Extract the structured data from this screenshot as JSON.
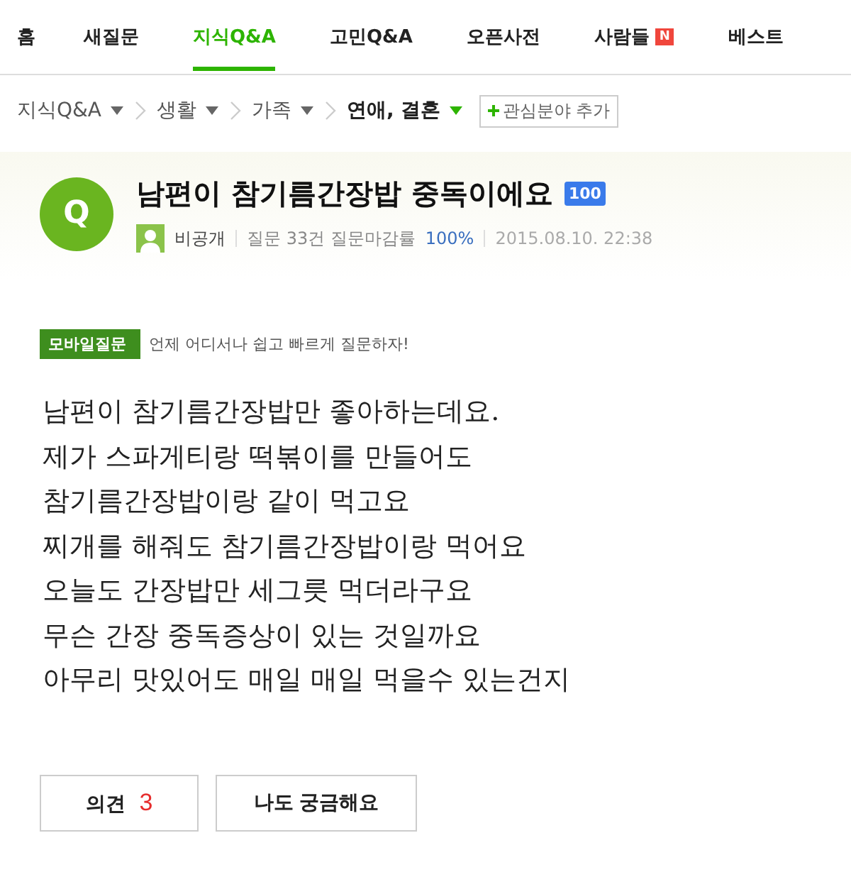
{
  "nav": [
    {
      "label": "홈",
      "selected": false
    },
    {
      "label": "새질문",
      "selected": false
    },
    {
      "label": "지식Q&A",
      "selected": true
    },
    {
      "label": "고민Q&A",
      "selected": false
    },
    {
      "label": "오픈사전",
      "selected": false
    },
    {
      "label": "사람들",
      "selected": false,
      "badge": "N"
    },
    {
      "label": "베스트",
      "selected": false
    }
  ],
  "breadcrumb": [
    {
      "label": "지식Q&A",
      "current": false
    },
    {
      "label": "생활",
      "current": false
    },
    {
      "label": "가족",
      "current": false
    },
    {
      "label": "연애, 결혼",
      "current": true
    }
  ],
  "add_interest": "관심분야 추가",
  "question": {
    "badge": "Q",
    "title": "남편이 참기름간장밥 중독이에요",
    "points": "100",
    "author": "비공개",
    "stats": "질문 33건 질문마감률",
    "rate": "100%",
    "date": "2015.08.10. 22:38"
  },
  "mobile": {
    "tag": "모바일질문",
    "text": "언제 어디서나 쉽고 빠르게 질문하자!"
  },
  "body": [
    "남편이 참기름간장밥만 좋아하는데요.",
    "제가 스파게티랑 떡볶이를 만들어도",
    "참기름간장밥이랑 같이 먹고요",
    "찌개를 해줘도 참기름간장밥이랑 먹어요",
    "오늘도 간장밥만 세그릇 먹더라구요",
    "무슨 간장 중독증상이 있는 것일까요",
    "아무리 맛있어도 매일 매일 먹을수 있는건지"
  ],
  "buttons": [
    {
      "label": "의견",
      "count": "3"
    },
    {
      "label": "나도 궁금해요"
    }
  ]
}
